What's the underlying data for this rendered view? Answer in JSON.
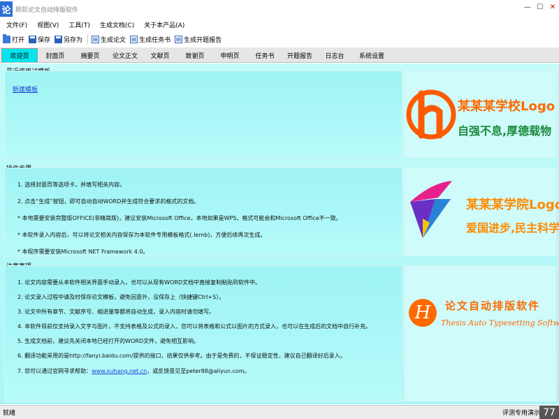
{
  "window": {
    "title": "熙凯论文自动排版软件",
    "icon_char": "论",
    "minimize_glyph": "—",
    "maximize_glyph": "☐",
    "close_glyph": "✕"
  },
  "menu": [
    "文件(F)",
    "视图(V)",
    "工具(T)",
    "生成文档(C)",
    "关于本产品(A)"
  ],
  "toolbar": {
    "open": "打开",
    "save": "保存",
    "save_as": "另存为",
    "gen_paper": "生成论文",
    "gen_task": "生成任务书",
    "gen_report": "生成开题报告"
  },
  "tabs": [
    "欢迎页",
    "封面页",
    "摘要页",
    "论文正文",
    "文献页",
    "致谢页",
    "申明页",
    "任务书",
    "开题报告",
    "日志台",
    "系统设置"
  ],
  "active_tab": "欢迎页",
  "recent": {
    "title": "最近使用过模板",
    "new_template": "新建模板"
  },
  "steps": {
    "title": "操作步骤",
    "items": [
      "1. 选择封面页等选项卡，并填写相关内容。",
      "2. 点击“生成”按钮，即可自动自动WORD并生成符合要求的格式的文档。",
      "* 本地需要安装完整版OFFICE(非精简版)，建议安装Microsoft Office，本地如果是WPS，格式可能会和Microsoft Office不一致。",
      "* 本软件录入内容后，可以将论文相关内容保存为本软件专用模板格式(.lemb)，方便后续再次生成。",
      "* 本程序需要安装Microsoft NET Framework 4.0。"
    ]
  },
  "notes": {
    "title": "注意事项",
    "items": [
      "1. 论文内容需要从本软件相关界面手动录入，也可以从现有WORD文档中直接复制粘贴到软件中。",
      "2. 论文录入过程中请及时保存论文模板，避免因意外，没保存上（快捷键Ctrl+S）。",
      "3. 论文中所有章节、文献序号、缩进量等都将自动生成，录入内容时请勿填写。",
      "4. 本软件目前仅支持录入文字与图片，不支持表格及公式的录入，您可以将表格和公式以图片的方式录入，也可以在生成后的文档中自行补充。",
      "5. 生成文档前，建议先关闭本地已经打开的WORD文件，避免相互影响。",
      "6. 翻译功能采用的是http://fanyi.baidu.com/提供的接口，结果仅供参考。由于是免费的，不保证稳定性，建议自己翻译好后录入。"
    ],
    "contact_prefix": "7. 您可以通过官网寻求帮助：",
    "contact_link": "www.xuhang.net.cn",
    "contact_suffix": "，或反馈意见至peter88@aliyun.com。"
  },
  "logos": {
    "school": {
      "line1": "某某某学校Logo",
      "line2": "自强不息,厚德载物",
      "mark": "h"
    },
    "college": {
      "line1": "某某某学院Logo",
      "line2": "爱国进步,民主科学"
    },
    "product": {
      "mark": "H",
      "cn": "论文自动排版软件",
      "en": "Thesis Auto Typesetting Software"
    }
  },
  "status": {
    "left": "就绪",
    "right": "评测专用演示",
    "badge": "77"
  },
  "colors": {
    "content_bg": "#b0f7f7",
    "active_tab": "#00e5ee",
    "logo_orange": "#ff6a00",
    "logo_green": "#1d8a3f",
    "link": "#1a3fd6"
  }
}
